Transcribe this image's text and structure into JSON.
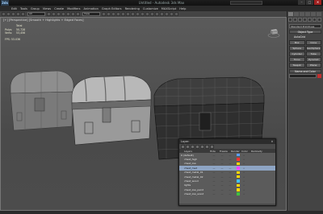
{
  "window": {
    "app_logo": "3ds",
    "title": "Untitled - Autodesk 3ds Max",
    "close": "✕",
    "minimize": "–",
    "maximize": "□"
  },
  "menu": [
    "Edit",
    "Tools",
    "Group",
    "Views",
    "Create",
    "Modifiers",
    "Animation",
    "Graph Editors",
    "Rendering",
    "Customize",
    "MAXScript",
    "Help"
  ],
  "toolbar": {
    "selection_filter": "All",
    "reference": "View"
  },
  "viewport": {
    "label": "[+] [Perspective] [Smooth + Highlights + Edged Faces]",
    "stats": [
      {
        "k": "",
        "v": "Total"
      },
      {
        "k": "Polys:",
        "v": "50,728"
      },
      {
        "k": "Verts:",
        "v": "53,456"
      }
    ],
    "fps_label": "FPS:",
    "fps_value": "53.036"
  },
  "command_panel": {
    "dropdown": "Standard Primitives",
    "rollout_object": "Object Type",
    "autogrid": "AutoGrid",
    "buttons": [
      "Box",
      "Cone",
      "Sphere",
      "GeoSphere",
      "Cylinder",
      "Tube",
      "Torus",
      "Pyramid",
      "Teapot",
      "Plane"
    ],
    "rollout_name": "Name and Color"
  },
  "layer_manager": {
    "title": "Layer:",
    "close": "✕",
    "columns": [
      "Layers",
      "Hide",
      "Freeze",
      "Render",
      "Color",
      "Radiosity"
    ],
    "rows": [
      {
        "name": "0 (default)",
        "selected": false,
        "color": "#5aa0ff"
      },
      {
        "name": "chest_high",
        "selected": false,
        "color": "#ff3030"
      },
      {
        "name": "chest_low",
        "selected": false,
        "color": "#ffd700"
      },
      {
        "name": "chest_med",
        "selected": true,
        "color": "#ff40ff"
      },
      {
        "name": "chest_metal_01",
        "selected": false,
        "color": "#ffd700"
      },
      {
        "name": "chest_metal_02",
        "selected": false,
        "color": "#ffd700"
      },
      {
        "name": "chest_wood",
        "selected": false,
        "color": "#40c0ff"
      },
      {
        "name": "lights",
        "selected": false,
        "color": "#ffd700"
      },
      {
        "name": "chest_low_paint",
        "selected": false,
        "color": "#ffd700"
      },
      {
        "name": "chest_low_wood",
        "selected": false,
        "color": "#40c040"
      }
    ]
  },
  "colors": {
    "accent": "#8ea5c4",
    "viewport_bg": "#555555"
  }
}
